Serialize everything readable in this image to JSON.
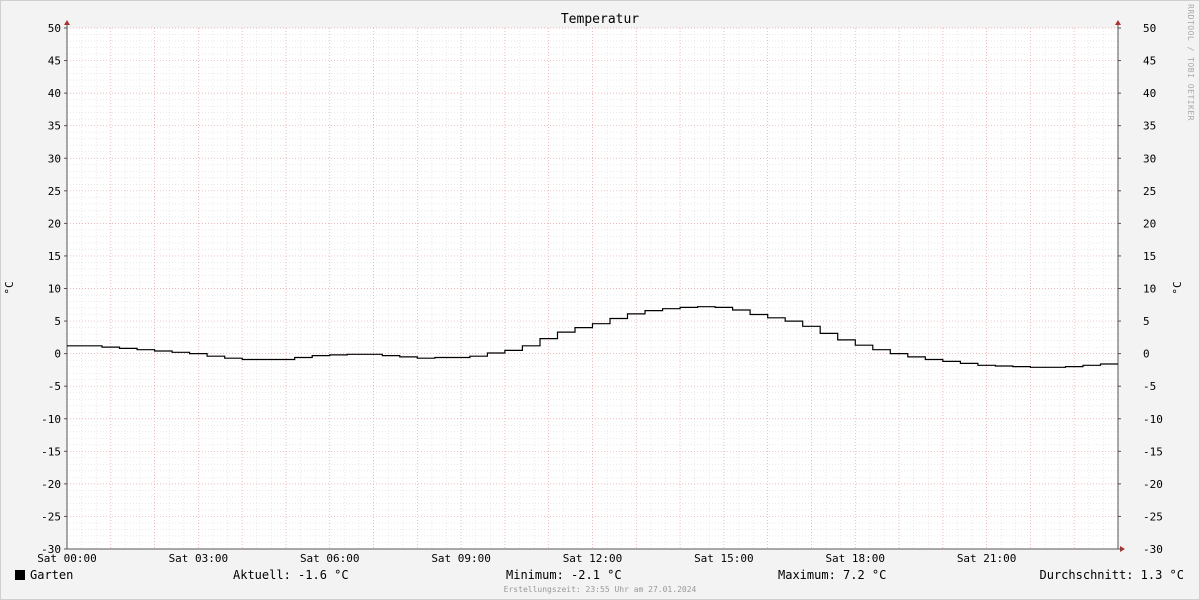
{
  "chart_data": {
    "type": "line",
    "title": "Temperatur",
    "ylabel": "°C",
    "ylabel_right": "°C",
    "xlabel": "",
    "ylim": [
      -30,
      50
    ],
    "xlim": [
      0,
      24
    ],
    "yticks": [
      50,
      45,
      40,
      35,
      30,
      25,
      20,
      15,
      10,
      5,
      0,
      -5,
      -10,
      -15,
      -20,
      -25,
      -30
    ],
    "xticks": [
      {
        "label": "Sat 00:00",
        "hour": 0
      },
      {
        "label": "Sat 03:00",
        "hour": 3
      },
      {
        "label": "Sat 06:00",
        "hour": 6
      },
      {
        "label": "Sat 09:00",
        "hour": 9
      },
      {
        "label": "Sat 12:00",
        "hour": 12
      },
      {
        "label": "Sat 15:00",
        "hour": 15
      },
      {
        "label": "Sat 18:00",
        "hour": 18
      },
      {
        "label": "Sat 21:00",
        "hour": 21
      }
    ],
    "grid": true,
    "series": [
      {
        "name": "Garten",
        "color": "#000000",
        "points": [
          [
            0.0,
            1.2
          ],
          [
            0.5,
            1.2
          ],
          [
            0.8,
            1.0
          ],
          [
            1.2,
            0.8
          ],
          [
            1.6,
            0.6
          ],
          [
            2.0,
            0.4
          ],
          [
            2.4,
            0.2
          ],
          [
            2.8,
            0.0
          ],
          [
            3.2,
            -0.4
          ],
          [
            3.6,
            -0.7
          ],
          [
            4.0,
            -0.9
          ],
          [
            4.4,
            -0.9
          ],
          [
            4.8,
            -0.9
          ],
          [
            5.2,
            -0.6
          ],
          [
            5.6,
            -0.3
          ],
          [
            6.0,
            -0.2
          ],
          [
            6.4,
            -0.1
          ],
          [
            6.8,
            -0.1
          ],
          [
            7.2,
            -0.3
          ],
          [
            7.6,
            -0.5
          ],
          [
            8.0,
            -0.7
          ],
          [
            8.4,
            -0.6
          ],
          [
            8.8,
            -0.6
          ],
          [
            9.2,
            -0.4
          ],
          [
            9.6,
            0.1
          ],
          [
            10.0,
            0.5
          ],
          [
            10.4,
            1.2
          ],
          [
            10.8,
            2.3
          ],
          [
            11.2,
            3.3
          ],
          [
            11.6,
            4.0
          ],
          [
            12.0,
            4.6
          ],
          [
            12.4,
            5.4
          ],
          [
            12.8,
            6.1
          ],
          [
            13.2,
            6.6
          ],
          [
            13.6,
            6.9
          ],
          [
            14.0,
            7.1
          ],
          [
            14.4,
            7.2
          ],
          [
            14.8,
            7.1
          ],
          [
            15.2,
            6.7
          ],
          [
            15.6,
            6.0
          ],
          [
            16.0,
            5.5
          ],
          [
            16.4,
            5.0
          ],
          [
            16.8,
            4.2
          ],
          [
            17.2,
            3.1
          ],
          [
            17.6,
            2.1
          ],
          [
            18.0,
            1.3
          ],
          [
            18.4,
            0.6
          ],
          [
            18.8,
            0.0
          ],
          [
            19.2,
            -0.5
          ],
          [
            19.6,
            -0.9
          ],
          [
            20.0,
            -1.2
          ],
          [
            20.4,
            -1.5
          ],
          [
            20.8,
            -1.8
          ],
          [
            21.2,
            -1.9
          ],
          [
            21.6,
            -2.0
          ],
          [
            22.0,
            -2.1
          ],
          [
            22.4,
            -2.1
          ],
          [
            22.8,
            -2.0
          ],
          [
            23.2,
            -1.8
          ],
          [
            23.6,
            -1.6
          ],
          [
            24.0,
            -1.6
          ]
        ]
      }
    ]
  },
  "footer": {
    "legend_label": "Garten",
    "current": "Aktuell: -1.6 °C",
    "minimum": "Minimum: -2.1 °C",
    "maximum": "Maximum: 7.2 °C",
    "average": "Durchschnitt: 1.3 °C",
    "created": "Erstellungszeit: 23:55 Uhr am 27.01.2024"
  },
  "watermark": "RRDTOOL / TOBI OETIKER"
}
